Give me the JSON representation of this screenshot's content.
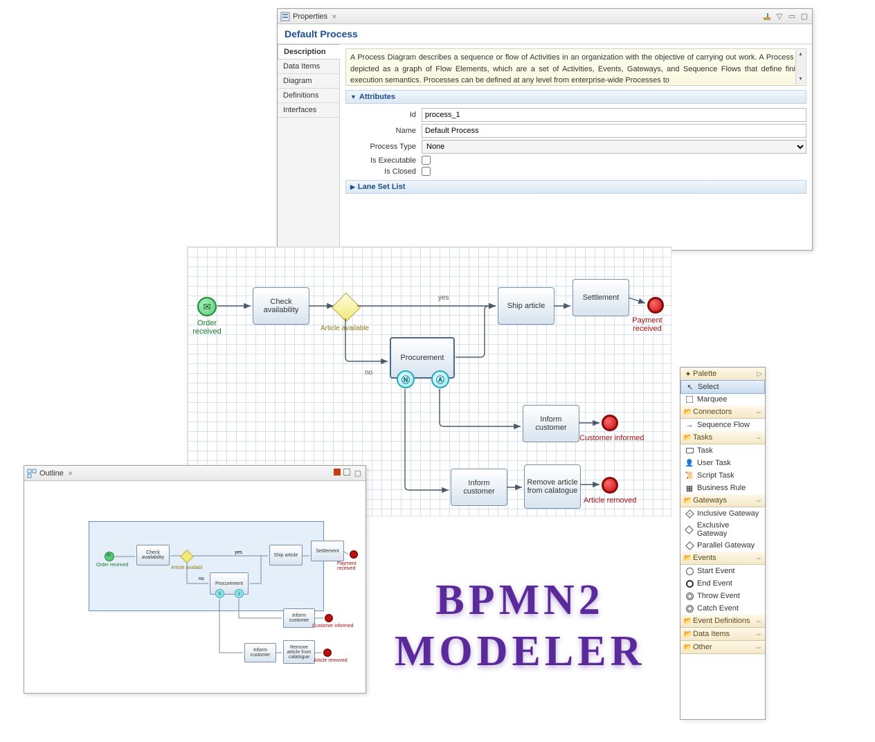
{
  "properties": {
    "panel_title": "Properties",
    "heading": "Default Process",
    "tabs": [
      "Description",
      "Data Items",
      "Diagram",
      "Definitions",
      "Interfaces"
    ],
    "description_text": "A Process Diagram describes a sequence or flow of Activities in an organization with the objective of carrying out work. A Process is depicted as a graph of Flow Elements, which are a set of Activities, Events, Gateways, and Sequence Flows that define finite execution semantics. Processes can be defined at any level from enterprise-wide Processes to",
    "attributes_section": "Attributes",
    "lanesetlist_section": "Lane Set List",
    "fields": {
      "id_label": "Id",
      "id_value": "process_1",
      "name_label": "Name",
      "name_value": "Default Process",
      "ptype_label": "Process Type",
      "ptype_value": "None",
      "exec_label": "Is Executable",
      "closed_label": "Is Closed"
    }
  },
  "diagram": {
    "start_label": "Order received",
    "check": "Check availability",
    "gateway_label": "Article available",
    "yes": "yes",
    "no": "no",
    "procurement": "Procurement",
    "ship": "Ship article",
    "settlement": "Settlement",
    "inform1": "Inform customer",
    "inform2": "Inform customer",
    "remove": "Remove article from calatogue",
    "end1": "Payment received",
    "end2": "Customer informed",
    "end3": "Article removed",
    "boundary1": "Ⓝ",
    "boundary2": "Ⓐ"
  },
  "outline": {
    "panel_title": "Outline"
  },
  "palette": {
    "title": "Palette",
    "select": "Select",
    "marquee": "Marquee",
    "connectors": "Connectors",
    "seqflow": "Sequence Flow",
    "tasks": "Tasks",
    "task": "Task",
    "usertask": "User Task",
    "scripttask": "Script Task",
    "bizrule": "Business Rule",
    "gateways": "Gateways",
    "incgw": "Inclusive Gateway",
    "excgw": "Exclusive Gateway",
    "pargw": "Parallel Gateway",
    "events": "Events",
    "startev": "Start Event",
    "endev": "End Event",
    "throwev": "Throw Event",
    "catchev": "Catch Event",
    "evdefs": "Event Definitions",
    "dataitems": "Data Items",
    "other": "Other"
  },
  "logo": {
    "line1": "BPMN2",
    "line2": "MODELER"
  }
}
